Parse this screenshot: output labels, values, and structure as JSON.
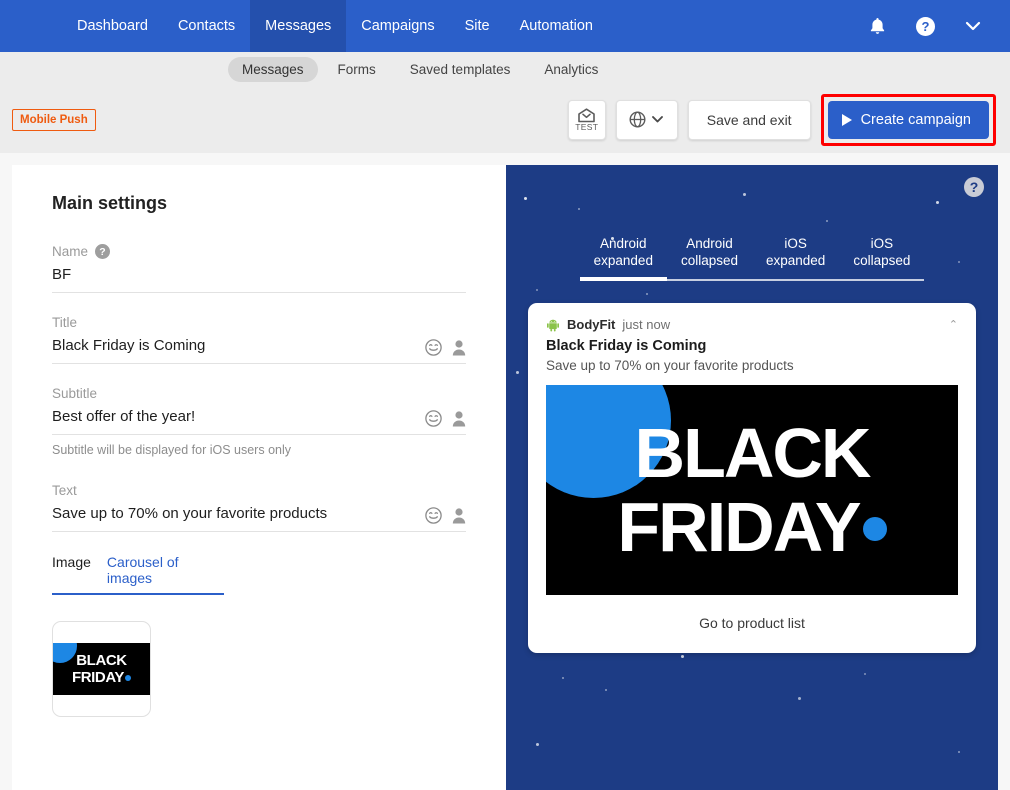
{
  "topnav": {
    "items": [
      {
        "label": "Dashboard",
        "active": false
      },
      {
        "label": "Contacts",
        "active": false
      },
      {
        "label": "Messages",
        "active": true
      },
      {
        "label": "Campaigns",
        "active": false
      },
      {
        "label": "Site",
        "active": false
      },
      {
        "label": "Automation",
        "active": false
      }
    ],
    "icons": {
      "notifications": "bell-icon",
      "help": "help-circle-icon",
      "account_menu": "chevron-down-icon"
    },
    "background_color": "#2b5fc9",
    "active_color": "#2450ad"
  },
  "subnav": {
    "items": [
      {
        "label": "Messages",
        "active": true
      },
      {
        "label": "Forms",
        "active": false
      },
      {
        "label": "Saved templates",
        "active": false
      },
      {
        "label": "Analytics",
        "active": false
      }
    ]
  },
  "actionbar": {
    "channel_badge": "Mobile Push",
    "channel_badge_color": "#ef5b10",
    "test_label": "TEST",
    "test_icon": "envelope-open-icon",
    "language_icon": "globe-icon",
    "language_chevron": "chevron-down-icon",
    "save_and_exit_label": "Save and exit",
    "create_campaign_label": "Create campaign",
    "create_campaign_icon": "play-triangle-icon",
    "highlight_color": "#fe0000",
    "primary_color": "#2b5fc9"
  },
  "main_settings": {
    "title": "Main settings",
    "fields": [
      {
        "label": "Name",
        "value": "BF",
        "has_help": true,
        "has_emoji": false,
        "has_personalize": false,
        "hint": ""
      },
      {
        "label": "Title",
        "value": "Black Friday is Coming",
        "has_help": false,
        "has_emoji": true,
        "has_personalize": true,
        "hint": ""
      },
      {
        "label": "Subtitle",
        "value": "Best offer of the year!",
        "has_help": false,
        "has_emoji": true,
        "has_personalize": true,
        "hint": "Subtitle will be displayed for iOS users only"
      },
      {
        "label": "Text",
        "value": "Save up to 70% on your favorite products",
        "has_help": false,
        "has_emoji": true,
        "has_personalize": true,
        "hint": ""
      }
    ],
    "image_tabs": [
      {
        "label": "Image",
        "active": true
      },
      {
        "label": "Carousel of images",
        "active": false
      }
    ],
    "thumbnail": {
      "line1": "BLACK",
      "line2": "FRIDAY"
    }
  },
  "preview": {
    "help_icon": "help-circle-icon",
    "background_color": "#1d3c85",
    "device_tabs": [
      {
        "line1": "Android",
        "line2": "expanded",
        "active": true
      },
      {
        "line1": "Android",
        "line2": "collapsed",
        "active": false
      },
      {
        "line1": "iOS",
        "line2": "expanded",
        "active": false
      },
      {
        "line1": "iOS",
        "line2": "collapsed",
        "active": false
      }
    ],
    "notification": {
      "app_icon": "android-robot-icon",
      "app_name": "BodyFit",
      "time": "just now",
      "collapse_icon": "chevron-up-icon",
      "title": "Black Friday is Coming",
      "text": "Save up to 70% on your favorite products",
      "banner": {
        "line1": "BLACK",
        "line2": "FRIDAY",
        "background_color": "#000000",
        "accent_color": "#1d87e4"
      },
      "action_label": "Go to product list"
    }
  }
}
